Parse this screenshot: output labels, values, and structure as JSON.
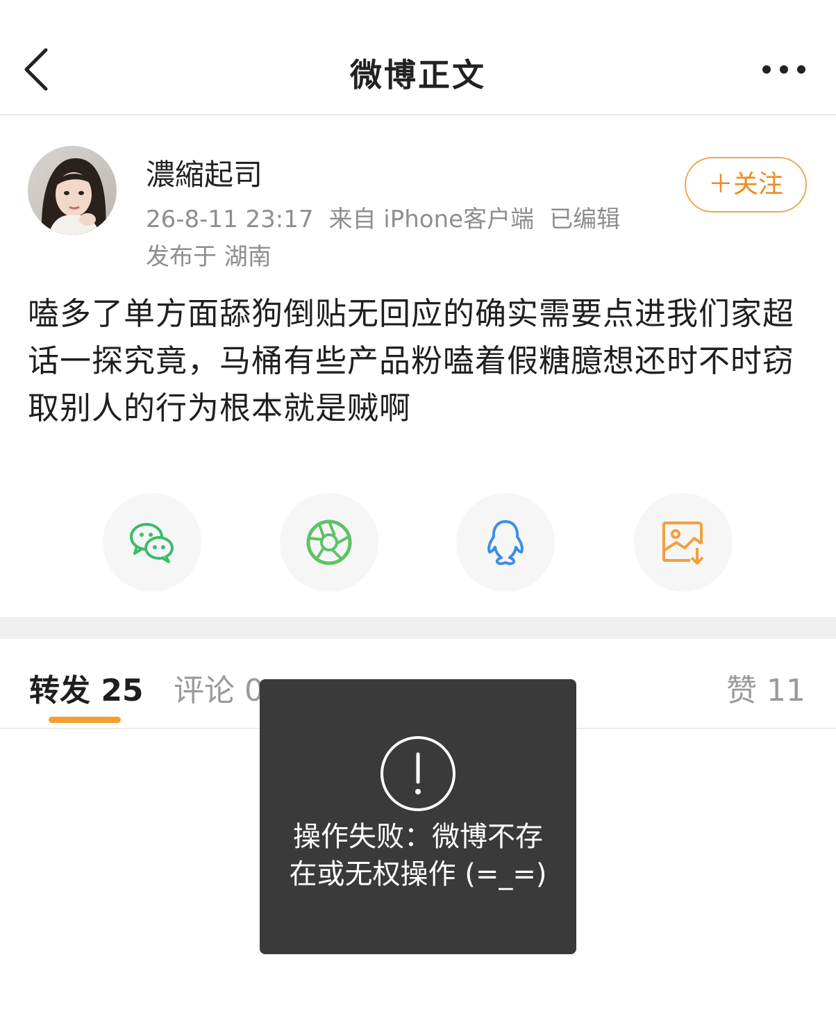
{
  "header": {
    "title": "微博正文"
  },
  "author": {
    "name": "濃縮起司",
    "time": "26-8-11 23:17",
    "source": "来自 iPhone客户端",
    "edited": "已编辑",
    "location": "发布于 湖南",
    "follow_label": "＋关注"
  },
  "post": {
    "text": "嗑多了单方面舔狗倒贴无回应的确实需要点进我们家超话一探究竟，马桶有些产品粉嗑着假糖臆想还时不时窃取别人的行为根本就是贼啊"
  },
  "share": [
    {
      "icon": "wechat-icon",
      "color": "#3dbb6b"
    },
    {
      "icon": "moments-icon",
      "color": "#5cc266"
    },
    {
      "icon": "qq-icon",
      "color": "#3a8ee6"
    },
    {
      "icon": "save-image-icon",
      "color": "#f2a03a"
    }
  ],
  "tabs": {
    "repost": "转发 25",
    "comment": "评论 0",
    "like": "赞 11"
  },
  "toast": {
    "message": "操作失败：微博不存在或无权操作 (=_=)"
  },
  "colors": {
    "accent": "#f79e2e",
    "follow": "#f08a1c",
    "toast_bg": "#3a3a3a"
  }
}
